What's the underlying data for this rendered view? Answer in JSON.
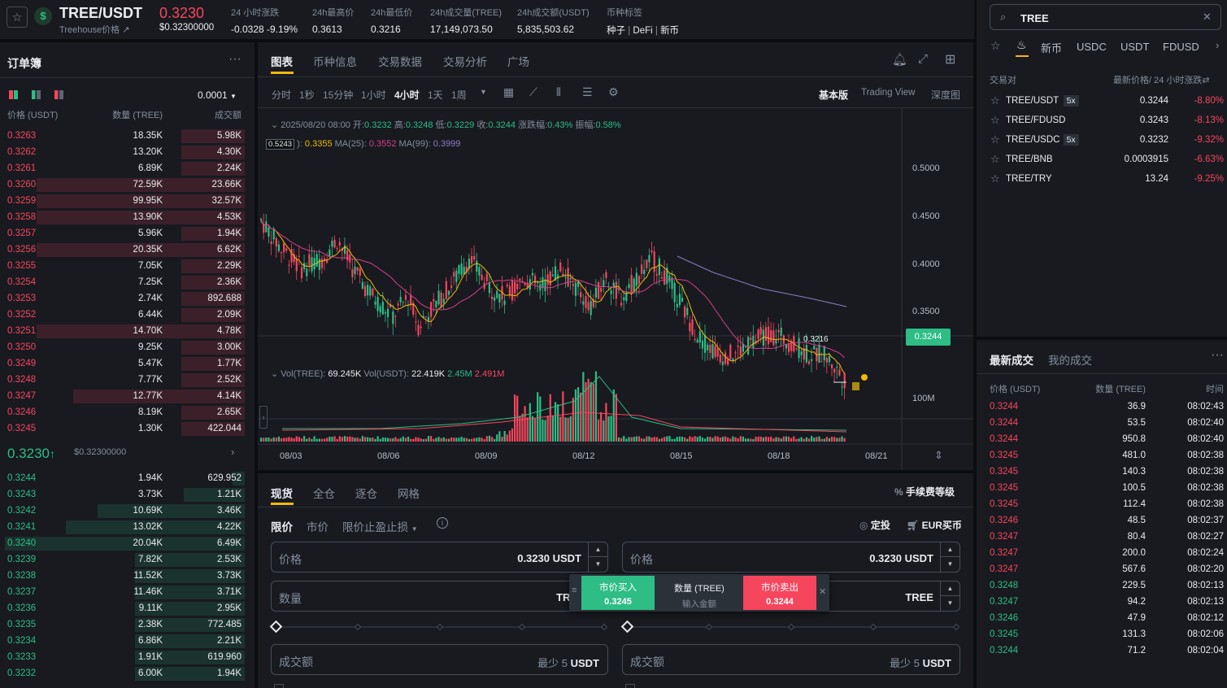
{
  "ticker": {
    "symbol": "TREE/USDT",
    "subtitle": "Treehouse价格",
    "last_price": "0.3230",
    "last_price_usd": "$0.32300000",
    "stats": [
      {
        "label": "24 小时涨跌",
        "value": "-0.0328 -9.19%",
        "color": "red"
      },
      {
        "label": "24h最高价",
        "value": "0.3613"
      },
      {
        "label": "24h最低价",
        "value": "0.3216"
      },
      {
        "label": "24h成交量(TREE)",
        "value": "17,149,073.50"
      },
      {
        "label": "24h成交额(USDT)",
        "value": "5,835,503.62"
      }
    ],
    "tag_label": "币种标签",
    "tags": [
      "种子",
      "DeFi",
      "新币"
    ]
  },
  "orderbook": {
    "title": "订单簿",
    "tick_size": "0.0001",
    "headers": [
      "价格 (USDT)",
      "数量 (TREE)",
      "成交额"
    ],
    "asks": [
      {
        "price": "0.3263",
        "qty": "18.35K",
        "total": "5.98K",
        "depth": 0.26
      },
      {
        "price": "0.3262",
        "qty": "13.20K",
        "total": "4.30K",
        "depth": 0.26
      },
      {
        "price": "0.3261",
        "qty": "6.89K",
        "total": "2.24K",
        "depth": 0.26
      },
      {
        "price": "0.3260",
        "qty": "72.59K",
        "total": "23.66K",
        "depth": 0.85
      },
      {
        "price": "0.3259",
        "qty": "99.95K",
        "total": "32.57K",
        "depth": 0.85
      },
      {
        "price": "0.3258",
        "qty": "13.90K",
        "total": "4.53K",
        "depth": 0.85
      },
      {
        "price": "0.3257",
        "qty": "5.96K",
        "total": "1.94K",
        "depth": 0.26
      },
      {
        "price": "0.3256",
        "qty": "20.35K",
        "total": "6.62K",
        "depth": 0.85
      },
      {
        "price": "0.3255",
        "qty": "7.05K",
        "total": "2.29K",
        "depth": 0.26
      },
      {
        "price": "0.3254",
        "qty": "7.25K",
        "total": "2.36K",
        "depth": 0.26
      },
      {
        "price": "0.3253",
        "qty": "2.74K",
        "total": "892.688",
        "depth": 0.26
      },
      {
        "price": "0.3252",
        "qty": "6.44K",
        "total": "2.09K",
        "depth": 0.26
      },
      {
        "price": "0.3251",
        "qty": "14.70K",
        "total": "4.78K",
        "depth": 0.85
      },
      {
        "price": "0.3250",
        "qty": "9.25K",
        "total": "3.00K",
        "depth": 0.26
      },
      {
        "price": "0.3249",
        "qty": "5.47K",
        "total": "1.77K",
        "depth": 0.26
      },
      {
        "price": "0.3248",
        "qty": "7.77K",
        "total": "2.52K",
        "depth": 0.26
      },
      {
        "price": "0.3247",
        "qty": "12.77K",
        "total": "4.14K",
        "depth": 0.7
      },
      {
        "price": "0.3246",
        "qty": "8.19K",
        "total": "2.65K",
        "depth": 0.26
      },
      {
        "price": "0.3245",
        "qty": "1.30K",
        "total": "422.044",
        "depth": 0.26
      }
    ],
    "mid_price": "0.3230",
    "mid_usd": "$0.32300000",
    "bids": [
      {
        "price": "0.3244",
        "qty": "1.94K",
        "total": "629.952",
        "depth": 0.05
      },
      {
        "price": "0.3243",
        "qty": "3.73K",
        "total": "1.21K",
        "depth": 0.25
      },
      {
        "price": "0.3242",
        "qty": "10.69K",
        "total": "3.46K",
        "depth": 0.6
      },
      {
        "price": "0.3241",
        "qty": "13.02K",
        "total": "4.22K",
        "depth": 0.73
      },
      {
        "price": "0.3240",
        "qty": "20.04K",
        "total": "6.49K",
        "depth": 0.98
      },
      {
        "price": "0.3239",
        "qty": "7.82K",
        "total": "2.53K",
        "depth": 0.45
      },
      {
        "price": "0.3238",
        "qty": "11.52K",
        "total": "3.73K",
        "depth": 0.45
      },
      {
        "price": "0.3237",
        "qty": "11.46K",
        "total": "3.71K",
        "depth": 0.45
      },
      {
        "price": "0.3236",
        "qty": "9.11K",
        "total": "2.95K",
        "depth": 0.45
      },
      {
        "price": "0.3235",
        "qty": "2.38K",
        "total": "772.485",
        "depth": 0.45
      },
      {
        "price": "0.3234",
        "qty": "6.86K",
        "total": "2.21K",
        "depth": 0.45
      },
      {
        "price": "0.3233",
        "qty": "1.91K",
        "total": "619.960",
        "depth": 0.45
      },
      {
        "price": "0.3232",
        "qty": "6.00K",
        "total": "1.94K",
        "depth": 0.45
      }
    ]
  },
  "chart": {
    "tabs": [
      "图表",
      "币种信息",
      "交易数据",
      "交易分析",
      "广场"
    ],
    "timeframes": [
      "分时",
      "1秒",
      "15分钟",
      "1小时",
      "4小时",
      "1天",
      "1周"
    ],
    "active_tf": "4小时",
    "views": [
      "基本版",
      "Trading View",
      "深度图"
    ],
    "ohlc": {
      "date": "2025/08/20 08:00",
      "open_l": "开:",
      "open": "0.3232",
      "high_l": "高:",
      "high": "0.3248",
      "low_l": "低:",
      "low": "0.3229",
      "close_l": "收:",
      "close": "0.3244",
      "chg_l": "涨跌幅:",
      "chg": "0.43%",
      "amp_l": "振幅:",
      "amp": "0.58%"
    },
    "ma": {
      "ma7_val": "0.5243",
      "ma7_label": "):",
      "ma7": "0.3355",
      "ma25_label": "MA(25):",
      "ma25": "0.3552",
      "ma99_label": "MA(99):",
      "ma99": "0.3999"
    },
    "y_ticks": [
      "0.5000",
      "0.4500",
      "0.4000",
      "0.3500"
    ],
    "current_price_tag": "0.3244",
    "low_label": "0.3216",
    "vol": {
      "l1": "Vol(TREE):",
      "v1": "69.245K",
      "l2": "Vol(USDT):",
      "v2": "22.419K",
      "v3": "2.45M",
      "v4": "2.491M",
      "axis": "100M"
    },
    "x_ticks": [
      "08/03",
      "08/06",
      "08/09",
      "08/12",
      "08/15",
      "08/18",
      "08/21"
    ],
    "colors": {
      "up": "#2ebd85",
      "down": "#f6465d",
      "ma7": "#f0b90b",
      "ma25": "#d63f8c",
      "ma99": "#8e7cc3"
    }
  },
  "trade": {
    "tabs": [
      "现货",
      "全仓",
      "逐仓",
      "网格"
    ],
    "fee_label": "手续费等级",
    "order_types": [
      "限价",
      "市价",
      "限价止盈止损"
    ],
    "dca_label": "定投",
    "eur_label": "EUR买币",
    "buy": {
      "price_label": "价格",
      "price": "0.3230",
      "unit": "USDT",
      "qty_label": "数量",
      "qty_unit": "TR",
      "total_label": "成交额",
      "min": "最少 5",
      "total_unit": "USDT"
    },
    "sell": {
      "price_label": "价格",
      "price": "0.3230",
      "unit": "USDT",
      "qty_unit": "TREE",
      "total_label": "成交额",
      "min": "最少 5",
      "total_unit": "USDT"
    },
    "popup": {
      "buy_label": "市价买入",
      "buy_price": "0.3245",
      "qty_label": "数量 (TREE)",
      "qty_placeholder": "输入金额",
      "sell_label": "市价卖出",
      "sell_price": "0.3244"
    }
  },
  "pairs": {
    "search_value": "TREE",
    "tabs": [
      "新币",
      "USDC",
      "USDT",
      "FDUSD"
    ],
    "header_left": "交易对",
    "header_right": "最新价格/ 24 小时涨跌",
    "rows": [
      {
        "pair": "TREE/USDT",
        "lev": "5x",
        "price": "0.3244",
        "chg": "-8.80%"
      },
      {
        "pair": "TREE/FDUSD",
        "lev": "",
        "price": "0.3243",
        "chg": "-8.13%"
      },
      {
        "pair": "TREE/USDC",
        "lev": "5x",
        "price": "0.3232",
        "chg": "-9.32%"
      },
      {
        "pair": "TREE/BNB",
        "lev": "",
        "price": "0.0003915",
        "chg": "-6.63%"
      },
      {
        "pair": "TREE/TRY",
        "lev": "",
        "price": "13.24",
        "chg": "-9.25%"
      }
    ]
  },
  "trades": {
    "tabs": [
      "最新成交",
      "我的成交"
    ],
    "headers": [
      "价格 (USDT)",
      "数量 (TREE)",
      "时间"
    ],
    "rows": [
      {
        "p": "0.3244",
        "q": "36.9",
        "t": "08:02:43",
        "side": "down"
      },
      {
        "p": "0.3244",
        "q": "53.5",
        "t": "08:02:40",
        "side": "down"
      },
      {
        "p": "0.3244",
        "q": "950.8",
        "t": "08:02:40",
        "side": "down"
      },
      {
        "p": "0.3245",
        "q": "481.0",
        "t": "08:02:38",
        "side": "down"
      },
      {
        "p": "0.3245",
        "q": "140.3",
        "t": "08:02:38",
        "side": "down"
      },
      {
        "p": "0.3245",
        "q": "100.5",
        "t": "08:02:38",
        "side": "down"
      },
      {
        "p": "0.3245",
        "q": "112.4",
        "t": "08:02:38",
        "side": "down"
      },
      {
        "p": "0.3246",
        "q": "48.5",
        "t": "08:02:37",
        "side": "down"
      },
      {
        "p": "0.3247",
        "q": "80.4",
        "t": "08:02:27",
        "side": "down"
      },
      {
        "p": "0.3247",
        "q": "200.0",
        "t": "08:02:24",
        "side": "down"
      },
      {
        "p": "0.3247",
        "q": "567.6",
        "t": "08:02:20",
        "side": "down"
      },
      {
        "p": "0.3248",
        "q": "229.5",
        "t": "08:02:13",
        "side": "up"
      },
      {
        "p": "0.3247",
        "q": "94.2",
        "t": "08:02:13",
        "side": "up"
      },
      {
        "p": "0.3246",
        "q": "47.9",
        "t": "08:02:12",
        "side": "up"
      },
      {
        "p": "0.3245",
        "q": "131.3",
        "t": "08:02:06",
        "side": "up"
      },
      {
        "p": "0.3244",
        "q": "71.2",
        "t": "08:02:04",
        "side": "up"
      }
    ]
  }
}
